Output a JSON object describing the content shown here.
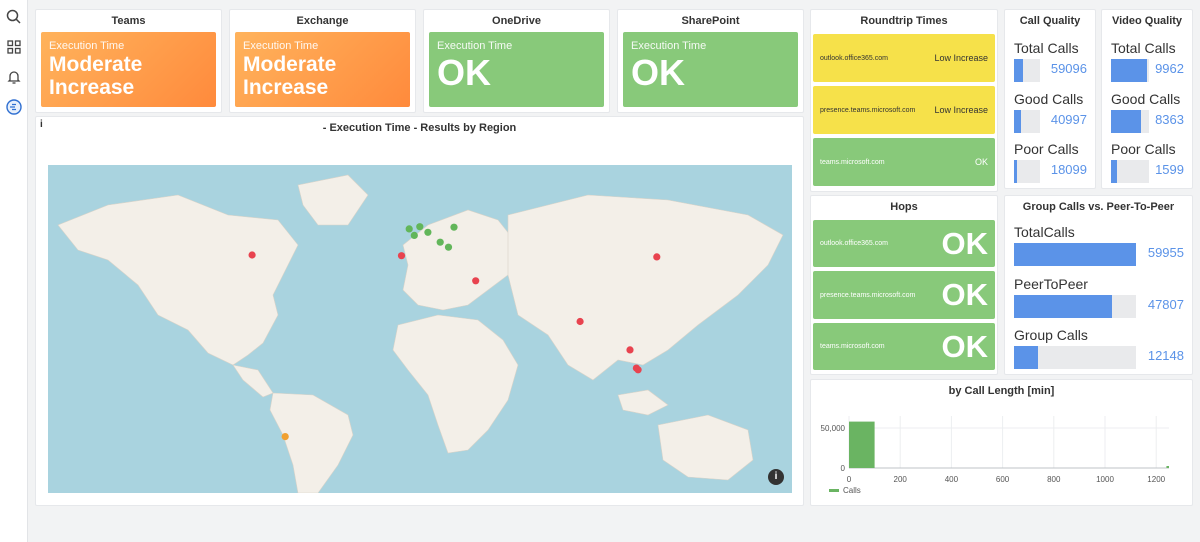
{
  "rail": {
    "icons": [
      "search-icon",
      "grid-icon",
      "bell-icon",
      "app-icon"
    ]
  },
  "teams": {
    "title": "Teams",
    "label": "Execution Time",
    "value": "Moderate Increase"
  },
  "exchange": {
    "title": "Exchange",
    "label": "Execution Time",
    "value": "Moderate Increase"
  },
  "onedrive": {
    "title": "OneDrive",
    "label": "Execution Time",
    "value": "OK"
  },
  "sharepoint": {
    "title": "SharePoint",
    "label": "Execution Time",
    "value": "OK"
  },
  "roundtrip": {
    "title": "Roundtrip Times",
    "items": [
      {
        "host": "outlook.office365.com",
        "status": "Low Increase",
        "color": "#f6e14a"
      },
      {
        "host": "presence.teams.microsoft.com",
        "status": "Low Increase",
        "color": "#f6e14a"
      },
      {
        "host": "teams.microsoft.com",
        "status": "OK",
        "color": "#88c97a"
      }
    ]
  },
  "hops": {
    "title": "Hops",
    "items": [
      {
        "host": "outlook.office365.com",
        "status": "OK"
      },
      {
        "host": "presence.teams.microsoft.com",
        "status": "OK"
      },
      {
        "host": "teams.microsoft.com",
        "status": "OK"
      }
    ]
  },
  "call_quality": {
    "title": "Call Quality",
    "metrics": [
      {
        "label": "Total Calls",
        "value": "59096",
        "fraction": 0.36
      },
      {
        "label": "Good Calls",
        "value": "40997",
        "fraction": 0.25
      },
      {
        "label": "Poor Calls",
        "value": "18099",
        "fraction": 0.11
      }
    ]
  },
  "video_quality": {
    "title": "Video Quality",
    "metrics": [
      {
        "label": "Total Calls",
        "value": "9962",
        "fraction": 0.95
      },
      {
        "label": "Good Calls",
        "value": "8363",
        "fraction": 0.8
      },
      {
        "label": "Poor Calls",
        "value": "1599",
        "fraction": 0.15
      }
    ]
  },
  "group_calls": {
    "title": "Group Calls vs. Peer-To-Peer",
    "metrics": [
      {
        "label": "TotalCalls",
        "value": "59955",
        "fraction": 1.0
      },
      {
        "label": "PeerToPeer",
        "value": "47807",
        "fraction": 0.8
      },
      {
        "label": "Group Calls",
        "value": "12148",
        "fraction": 0.2
      }
    ]
  },
  "map": {
    "info": "i",
    "title": "- Execution Time - Results by Region",
    "info_button": "i",
    "colors": {
      "red": "#e8434f",
      "green": "#62b65a",
      "orange": "#f0a030"
    },
    "points": [
      {
        "lon": -74,
        "lat": 40.7,
        "status": "red"
      },
      {
        "lon": -3.7,
        "lat": 40.4,
        "status": "red"
      },
      {
        "lon": -0.1,
        "lat": 51.5,
        "status": "green"
      },
      {
        "lon": 8.7,
        "lat": 50.1,
        "status": "green"
      },
      {
        "lon": 4.9,
        "lat": 52.4,
        "status": "green"
      },
      {
        "lon": 21,
        "lat": 52.2,
        "status": "green"
      },
      {
        "lon": 2.3,
        "lat": 48.8,
        "status": "green"
      },
      {
        "lon": 14.5,
        "lat": 46.0,
        "status": "green"
      },
      {
        "lon": 18.4,
        "lat": 43.9,
        "status": "green"
      },
      {
        "lon": 31.2,
        "lat": 30.0,
        "status": "red"
      },
      {
        "lon": 116.4,
        "lat": 39.9,
        "status": "red"
      },
      {
        "lon": 80.3,
        "lat": 13.1,
        "status": "red"
      },
      {
        "lon": 103.8,
        "lat": 1.35,
        "status": "red"
      },
      {
        "lon": 106.8,
        "lat": -6.2,
        "status": "red"
      },
      {
        "lon": 107.6,
        "lat": -6.9,
        "status": "red"
      },
      {
        "lon": -58.4,
        "lat": -34.6,
        "status": "orange"
      }
    ]
  },
  "chart_data": {
    "type": "bar",
    "title": "by Call Length [min]",
    "xlabel": "",
    "ylabel": "",
    "x": [
      0,
      1240
    ],
    "bins": [
      {
        "start": 0,
        "end": 100,
        "value": 58000
      }
    ],
    "values": [
      58000
    ],
    "xlim": [
      0,
      1250
    ],
    "ylim": [
      0,
      65000
    ],
    "x_ticks": [
      0,
      200,
      400,
      600,
      800,
      1000,
      1200
    ],
    "x_tick_labels": [
      "0",
      "200",
      "400",
      "600",
      "800",
      "1000",
      "1200"
    ],
    "y_ticks": [
      0,
      50000
    ],
    "y_tick_labels": [
      "0",
      "50,000"
    ],
    "series": [
      {
        "name": "Calls",
        "color": "#6ab462"
      }
    ],
    "legend": "bottom-left",
    "grid": true
  }
}
